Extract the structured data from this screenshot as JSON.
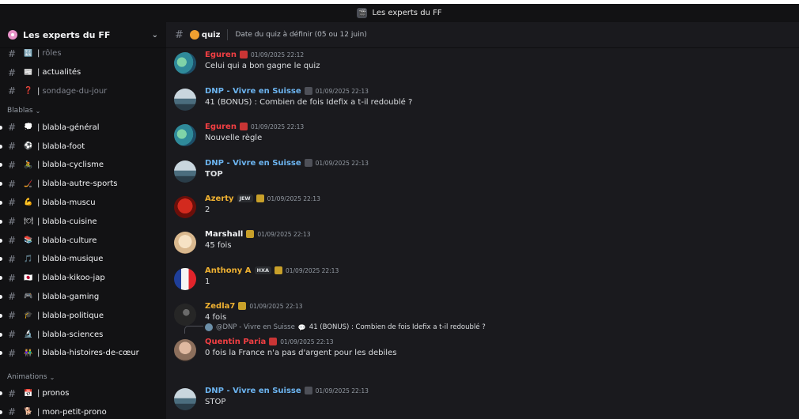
{
  "window": {
    "title": "Les experts du FF"
  },
  "server": {
    "name": "Les experts du FF"
  },
  "channels_top": [
    {
      "name": "rôles",
      "emoji": "🔣",
      "muted": true
    },
    {
      "name": "actualités",
      "emoji": "📰",
      "muted": false
    },
    {
      "name": "sondage-du-jour",
      "emoji": "❓",
      "muted": true
    }
  ],
  "categories": [
    {
      "name": "Blablas",
      "channels": [
        {
          "name": "blabla-général",
          "emoji": "💭"
        },
        {
          "name": "blabla-foot",
          "emoji": "⚽"
        },
        {
          "name": "blabla-cyclisme",
          "emoji": "🚴"
        },
        {
          "name": "blabla-autre-sports",
          "emoji": "🏒"
        },
        {
          "name": "blabla-muscu",
          "emoji": "💪"
        },
        {
          "name": "blabla-cuisine",
          "emoji": "🍽"
        },
        {
          "name": "blabla-culture",
          "emoji": "📚"
        },
        {
          "name": "blabla-musique",
          "emoji": "🎵"
        },
        {
          "name": "blabla-kikoo-jap",
          "emoji": "🇯🇵"
        },
        {
          "name": "blabla-gaming",
          "emoji": "🎮"
        },
        {
          "name": "blabla-politique",
          "emoji": "🎓"
        },
        {
          "name": "blabla-sciences",
          "emoji": "🔬"
        },
        {
          "name": "blabla-histoires-de-cœur",
          "emoji": "👫"
        }
      ]
    },
    {
      "name": "Animations",
      "channels": [
        {
          "name": "pronos",
          "emoji": "📅"
        },
        {
          "name": "mon-petit-prono",
          "emoji": "🐕"
        }
      ]
    }
  ],
  "channel": {
    "name": "quiz",
    "topic": "Date du quiz à définir (05 ou 12 juin)"
  },
  "messages": [
    {
      "author": "Eguren",
      "color": "#f23f43",
      "time": "01/09/2025 22:12",
      "text": "Celui qui a bon gagne le quiz",
      "avatar": "beach"
    },
    {
      "author": "DNP - Vivre en Suisse",
      "color": "#6cb4f0",
      "time": "01/09/2025 22:13",
      "text": "41 (BONUS) : Combien de fois Idefix a t-il redoublé ?",
      "avatar": "lake"
    },
    {
      "author": "Eguren",
      "color": "#f23f43",
      "time": "01/09/2025 22:13",
      "text": "Nouvelle règle",
      "avatar": "beach"
    },
    {
      "author": "DNP - Vivre en Suisse",
      "color": "#6cb4f0",
      "time": "01/09/2025 22:13",
      "text": "TOP",
      "avatar": "lake"
    },
    {
      "author": "Azerty",
      "color": "#f0b232",
      "tag": "JEW",
      "time": "01/09/2025 22:13",
      "text": "2",
      "avatar": "red"
    },
    {
      "author": "Marshall",
      "color": "#f2f3f5",
      "time": "01/09/2025 22:13",
      "text": "45 fois",
      "avatar": "anime"
    },
    {
      "author": "Anthony A",
      "color": "#f0b232",
      "tag": "HXA",
      "time": "01/09/2025 22:13",
      "text": "1",
      "avatar": "flag"
    },
    {
      "author": "Zedla7",
      "color": "#f0b232",
      "time": "01/09/2025 22:13",
      "text": "4 fois",
      "avatar": "dark"
    },
    {
      "author": "Quentin Paria",
      "color": "#f23f43",
      "time": "01/09/2025 22:13",
      "text": "0 fois la France n'a pas d'argent pour les debiles",
      "avatar": "face",
      "reply": {
        "name": "@DNP - Vivre en Suisse",
        "text": "41 (BONUS) : Combien de fois Idefix a t-il redoublé ?"
      }
    },
    {
      "author": "DNP - Vivre en Suisse",
      "color": "#6cb4f0",
      "time": "01/09/2025 22:13",
      "text": "STOP",
      "avatar": "lake"
    }
  ]
}
